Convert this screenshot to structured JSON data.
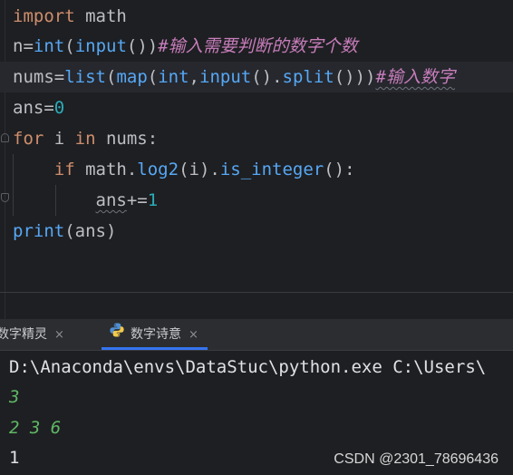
{
  "editor": {
    "lines": [
      {
        "id": "line-1",
        "tokens": [
          {
            "t": "import",
            "c": "kw"
          },
          {
            "t": " math",
            "c": ""
          }
        ]
      },
      {
        "id": "line-2",
        "tokens": [
          {
            "t": "n",
            "c": ""
          },
          {
            "t": "=",
            "c": ""
          },
          {
            "t": "int",
            "c": "fn"
          },
          {
            "t": "(",
            "c": ""
          },
          {
            "t": "input",
            "c": "fn"
          },
          {
            "t": "())",
            "c": ""
          },
          {
            "t": "#输入需要判断的数字个数",
            "c": "cmt"
          }
        ]
      },
      {
        "id": "line-3",
        "tokens": [
          {
            "t": "nums",
            "c": ""
          },
          {
            "t": "=",
            "c": ""
          },
          {
            "t": "list",
            "c": "fn"
          },
          {
            "t": "(",
            "c": ""
          },
          {
            "t": "map",
            "c": "fn"
          },
          {
            "t": "(",
            "c": ""
          },
          {
            "t": "int",
            "c": "fn"
          },
          {
            "t": ",",
            "c": ""
          },
          {
            "t": "input",
            "c": "fn"
          },
          {
            "t": "().",
            "c": ""
          },
          {
            "t": "split",
            "c": "fn"
          },
          {
            "t": "()))",
            "c": ""
          },
          {
            "t": "#输入数字",
            "c": "cmt wavy"
          }
        ]
      },
      {
        "id": "line-4",
        "tokens": [
          {
            "t": "ans",
            "c": ""
          },
          {
            "t": "=",
            "c": ""
          },
          {
            "t": "0",
            "c": "num"
          }
        ]
      },
      {
        "id": "line-5",
        "tokens": [
          {
            "t": "for",
            "c": "kw"
          },
          {
            "t": " i ",
            "c": ""
          },
          {
            "t": "in",
            "c": "kw"
          },
          {
            "t": " nums:",
            "c": ""
          }
        ]
      },
      {
        "id": "line-6",
        "tokens": [
          {
            "t": "    ",
            "c": ""
          },
          {
            "t": "if",
            "c": "kw"
          },
          {
            "t": " math.",
            "c": ""
          },
          {
            "t": "log2",
            "c": "fn"
          },
          {
            "t": "(i).",
            "c": ""
          },
          {
            "t": "is_integer",
            "c": "fn"
          },
          {
            "t": "():",
            "c": ""
          }
        ]
      },
      {
        "id": "line-7",
        "tokens": [
          {
            "t": "        ",
            "c": ""
          },
          {
            "t": "ans",
            "c": "wavy"
          },
          {
            "t": "+=",
            "c": ""
          },
          {
            "t": "1",
            "c": "num"
          }
        ]
      },
      {
        "id": "line-8",
        "tokens": [
          {
            "t": "print",
            "c": "fn"
          },
          {
            "t": "(ans)",
            "c": ""
          }
        ]
      }
    ]
  },
  "run_panel": {
    "tabs": [
      {
        "label": "数字精灵",
        "close": "×",
        "icon": "python-icon",
        "active": false
      },
      {
        "label": "数字诗意",
        "close": "×",
        "icon": "python-icon",
        "active": true
      }
    ],
    "output": [
      {
        "text": "D:\\Anaconda\\envs\\DataStuc\\python.exe C:\\Users\\",
        "kind": "out-cmd"
      },
      {
        "text": "3",
        "kind": "out-in"
      },
      {
        "text": "2 3 6",
        "kind": "out-in"
      },
      {
        "text": "1",
        "kind": "out-res"
      }
    ]
  },
  "watermark": "CSDN @2301_78696436",
  "colors": {
    "background": "#1e1f22",
    "keyword": "#cf8e6d",
    "function": "#56a8f5",
    "number": "#2aacb8",
    "comment": "#c77dbb",
    "user_input": "#5fb865",
    "accent": "#3574f0"
  }
}
